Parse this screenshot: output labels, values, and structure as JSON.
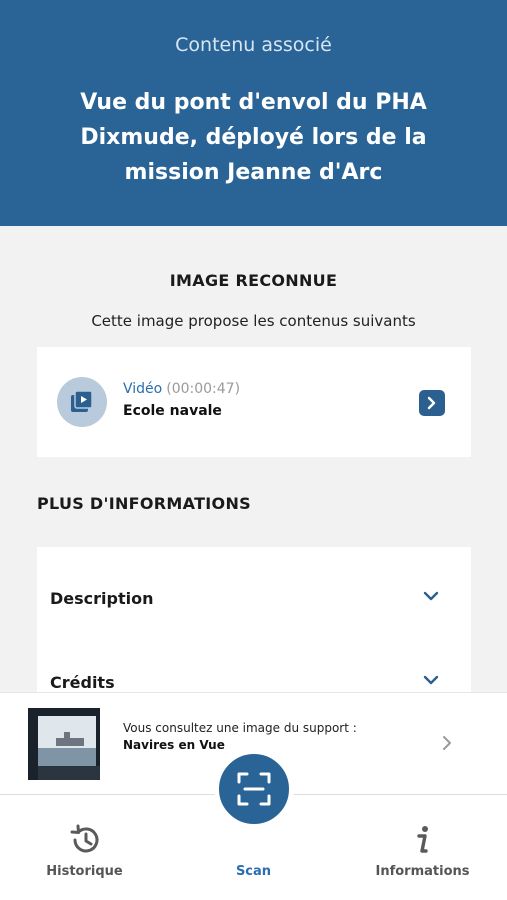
{
  "header": {
    "kicker": "Contenu associé",
    "title": "Vue du pont d'envol du PHA Dixmude, déployé lors de la mission Jeanne d'Arc"
  },
  "recognized": {
    "title": "IMAGE RECONNUE",
    "subtitle": "Cette image propose les contenus suivants"
  },
  "video": {
    "type": "Vidéo",
    "duration": "(00:00:47)",
    "title": "Ecole navale",
    "icon": "video-library-icon"
  },
  "more": {
    "title": "PLUS D'INFORMATIONS",
    "items": [
      {
        "label": "Description"
      },
      {
        "label": "Crédits"
      }
    ]
  },
  "support": {
    "text": "Vous consultez une image du support :",
    "name": "Navires en Vue"
  },
  "nav": {
    "items": [
      {
        "label": "Historique",
        "icon": "history-icon"
      },
      {
        "label": "Scan",
        "icon": "scan-icon"
      },
      {
        "label": "Informations",
        "icon": "info-icon"
      }
    ],
    "active": "Scan"
  },
  "colors": {
    "primary": "#2a6496",
    "accent": "#2a6eb0",
    "background": "#f2f2f2"
  }
}
